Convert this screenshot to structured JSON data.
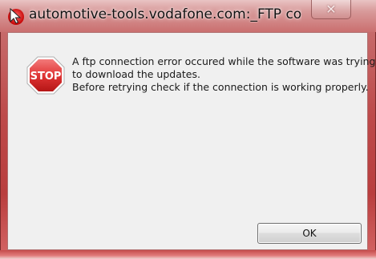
{
  "window": {
    "title": "automotive-tools.vodafone.com:_FTP connection er...",
    "close_symbol": "✕",
    "app_icon": "vodafone-cursor-icon",
    "frame_color": "#c0504d"
  },
  "dialog": {
    "icon": "stop-sign-icon",
    "icon_text": "STOP",
    "message_lines": [
      "A ftp connection error occured while the software was trying",
      "to download the updates.",
      "Before retrying check if the connection is working properly."
    ],
    "ok_label": "OK"
  }
}
